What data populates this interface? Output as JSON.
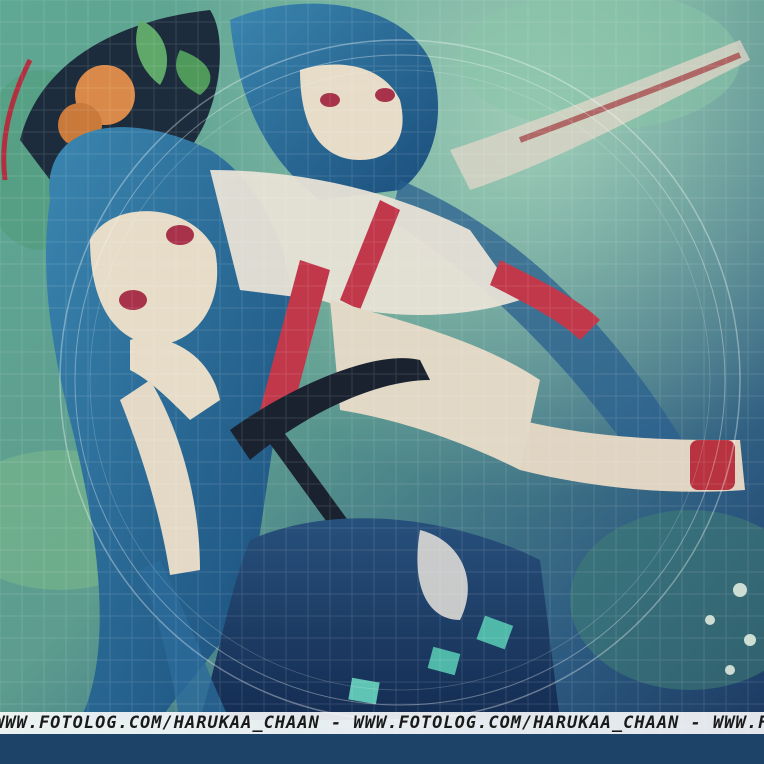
{
  "image": {
    "description_tags": [
      "anime-illustration",
      "two-characters",
      "blue-hair",
      "teal-tint"
    ],
    "palette": {
      "teal_light": "#7fbfa8",
      "teal_mid": "#3f8c86",
      "blue_deep": "#1d3e6e",
      "hair_blue": "#2a6fa0",
      "ribbon_red": "#c0384a",
      "skin": "#e6dcc8",
      "hat_black": "#1a2a38",
      "peach_orange": "#d98a4a",
      "leaf_green": "#5fa86a"
    }
  },
  "watermark": {
    "text": "WWW.FOTOLOG.COM/HARUKAA_CHAAN - WWW.FOTOLOG.COM/HARUKAA_CHAAN - WWW.FOTOLOG"
  }
}
